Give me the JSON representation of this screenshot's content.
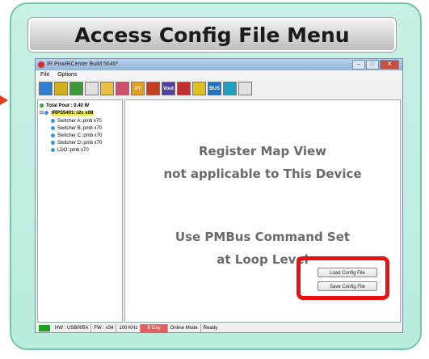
{
  "banner": {
    "title": "Access Config File Menu"
  },
  "window": {
    "title": "IR PowIRCenter Build 5646*",
    "controls": {
      "minimize": "–",
      "maximize": "□",
      "close": "✕"
    },
    "menu": [
      "File",
      "Options"
    ]
  },
  "toolbar": {
    "buttons": [
      {
        "icon": "device-settings-icon",
        "color": "#2f7fd0"
      },
      {
        "icon": "grid-icon",
        "color": "#d0b020"
      },
      {
        "icon": "network-icon",
        "color": "#3a9a3a"
      },
      {
        "icon": "document-icon",
        "color": "#e0e0e0"
      },
      {
        "icon": "folder-icon",
        "color": "#e8c040"
      },
      {
        "icon": "save-icon",
        "color": "#d05070"
      },
      {
        "icon": "xy-icon",
        "label": "XY",
        "color": "#e0a020"
      },
      {
        "icon": "chart-icon",
        "color": "#c04020"
      },
      {
        "icon": "vout-icon",
        "label": "Vout",
        "color": "#5040a0"
      },
      {
        "icon": "sequence-icon",
        "color": "#c03030"
      },
      {
        "icon": "monitor-icon",
        "color": "#e0c020"
      },
      {
        "icon": "bus-icon",
        "label": "BUS",
        "color": "#2070c0"
      },
      {
        "icon": "calculator-icon",
        "color": "#20a0c0"
      },
      {
        "icon": "lifebuoy-icon",
        "color": "#e0e0e0"
      }
    ]
  },
  "tree": {
    "total": "Total Pout : 0.40 W",
    "device": "IRPS5401::i2c x08",
    "children": [
      "Switcher A::pmb x70",
      "Switcher B::pmb x70",
      "Switcher C::pmb x70",
      "Switcher D::pmb x70",
      "LDO::pmb x70"
    ]
  },
  "main": {
    "line1": "Register Map View",
    "line2": "not applicable to This Device",
    "line3": "Use PMBus Command Set",
    "line4": "at Loop Level",
    "load_button": "Load Config File",
    "save_button": "Save Config File"
  },
  "status": {
    "hw": "HW : USB005A",
    "fw": "FW : v34",
    "freq": "100 KHz",
    "bday": "B Day",
    "mode": "Online Mode",
    "state": "Ready"
  }
}
